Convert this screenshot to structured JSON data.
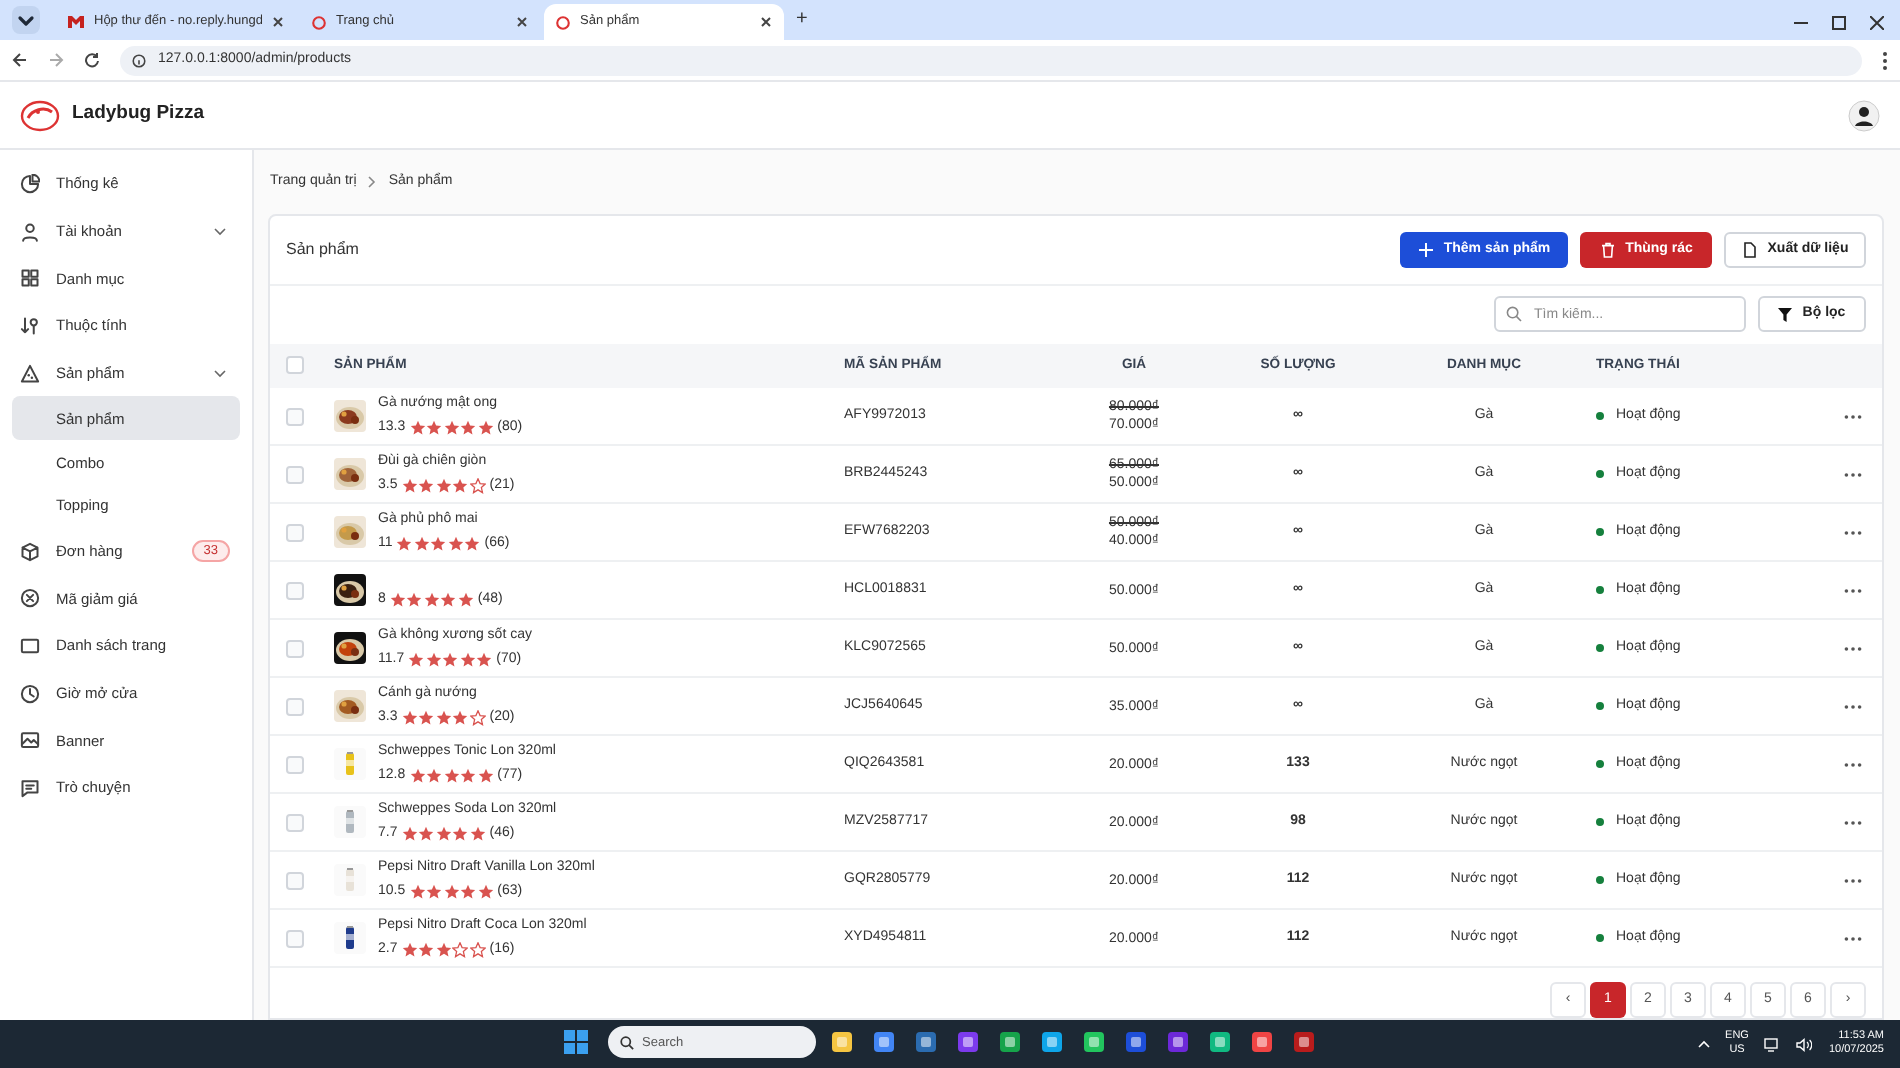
{
  "browser": {
    "tabs": [
      {
        "title": "Hộp thư đến - no.reply.hungd",
        "selected": false
      },
      {
        "title": "Trang chủ",
        "selected": false
      },
      {
        "title": "Sản phẩm",
        "selected": true
      }
    ],
    "new_tab": "+",
    "url": "127.0.0.1:8000/admin/products"
  },
  "app": {
    "brand": "Ladybug Pizza"
  },
  "sidebar": {
    "items": [
      {
        "label": "Thống kê",
        "kind": "link",
        "selected": false
      },
      {
        "label": "Tài khoản",
        "kind": "group",
        "selected": false
      },
      {
        "label": "Danh mục",
        "kind": "link",
        "selected": false
      },
      {
        "label": "Thuộc tính",
        "kind": "link",
        "selected": false
      },
      {
        "label": "Sản phẩm",
        "kind": "group",
        "selected": false,
        "children": [
          {
            "label": "Sản phẩm",
            "selected": true
          },
          {
            "label": "Combo",
            "selected": false
          },
          {
            "label": "Topping",
            "selected": false
          }
        ]
      },
      {
        "label": "Đơn hàng",
        "kind": "link",
        "selected": false,
        "badge": "33"
      },
      {
        "label": "Mã giảm giá",
        "kind": "link",
        "selected": false
      },
      {
        "label": "Danh sách trang",
        "kind": "link",
        "selected": false
      },
      {
        "label": "Giờ mở cửa",
        "kind": "link",
        "selected": false
      },
      {
        "label": "Banner",
        "kind": "link",
        "selected": false
      },
      {
        "label": "Trò chuyện",
        "kind": "link",
        "selected": false
      }
    ]
  },
  "breadcrumb": [
    "Trang quản trị",
    "Sản phẩm"
  ],
  "card": {
    "title": "Sản phẩm",
    "buttons": [
      {
        "label": "Thêm sản phẩm",
        "kind": "primary"
      },
      {
        "label": "Thùng rác",
        "kind": "danger"
      },
      {
        "label": "Xuất dữ liệu",
        "kind": "outline"
      }
    ],
    "search": {
      "placeholder": "Tìm kiếm..."
    },
    "filter": "Bộ lọc"
  },
  "table": {
    "select_all": {
      "checked": false
    },
    "columns": [
      "SẢN PHẨM",
      "MÃ SẢN PHẨM",
      "GIÁ",
      "SỐ LƯỢNG",
      "DANH MỤC",
      "TRẠNG THÁI"
    ],
    "rows": [
      {
        "checked": false,
        "name": "Gà nướng mật ong",
        "rating": "13.3",
        "stars": 5,
        "reviews": "(80)",
        "code": "AFY9972013",
        "old_price": "80.000₫",
        "price": "70.000₫",
        "quantity": "∞",
        "category": "Gà",
        "status": "Hoạt động",
        "color": "#15803d"
      },
      {
        "checked": false,
        "name": "Đùi gà chiên giòn",
        "rating": "3.5",
        "stars": 4,
        "reviews": "(21)",
        "code": "BRB2445243",
        "old_price": "65.000₫",
        "price": "50.000₫",
        "quantity": "∞",
        "category": "Gà",
        "status": "Hoạt động",
        "color": "#15803d"
      },
      {
        "checked": false,
        "name": "Gà phủ phô mai",
        "rating": "11",
        "stars": 5,
        "reviews": "(66)",
        "code": "EFW7682203",
        "old_price": "50.000₫",
        "price": "40.000₫",
        "quantity": "∞",
        "category": "Gà",
        "status": "Hoạt động",
        "color": "#15803d"
      },
      {
        "checked": false,
        "rating": "8",
        "stars": 5,
        "reviews": "(48)",
        "code": "HCL0018831",
        "price": "50.000₫",
        "quantity": "∞",
        "category": "Gà",
        "status": "Hoạt động",
        "color": "#15803d"
      },
      {
        "checked": false,
        "name": "Gà không xương sốt cay",
        "rating": "11.7",
        "stars": 5,
        "reviews": "(70)",
        "code": "KLC9072565",
        "price": "50.000₫",
        "quantity": "∞",
        "category": "Gà",
        "status": "Hoạt động",
        "color": "#15803d"
      },
      {
        "checked": false,
        "name": "Cánh gà nướng",
        "rating": "3.3",
        "stars": 4,
        "reviews": "(20)",
        "code": "JCJ5640645",
        "price": "35.000₫",
        "quantity": "∞",
        "category": "Gà",
        "status": "Hoạt động",
        "color": "#15803d"
      },
      {
        "checked": false,
        "name": "Schweppes Tonic Lon 320ml",
        "rating": "12.8",
        "stars": 5,
        "reviews": "(77)",
        "code": "QIQ2643581",
        "price": "20.000₫",
        "quantity": "133",
        "category": "Nước ngọt",
        "status": "Hoạt động",
        "color": "#15803d"
      },
      {
        "checked": false,
        "name": "Schweppes Soda Lon 320ml",
        "rating": "7.7",
        "stars": 5,
        "reviews": "(46)",
        "code": "MZV2587717",
        "price": "20.000₫",
        "quantity": "98",
        "category": "Nước ngọt",
        "status": "Hoạt động",
        "color": "#15803d"
      },
      {
        "checked": false,
        "name": "Pepsi Nitro Draft Vanilla Lon 320ml",
        "rating": "10.5",
        "stars": 5,
        "reviews": "(63)",
        "code": "GQR2805779",
        "price": "20.000₫",
        "quantity": "112",
        "category": "Nước ngọt",
        "status": "Hoạt động",
        "color": "#15803d"
      },
      {
        "checked": false,
        "name": "Pepsi Nitro Draft Coca Lon 320ml",
        "rating": "2.7",
        "stars": 3,
        "reviews": "(16)",
        "code": "XYD4954811",
        "price": "20.000₫",
        "quantity": "112",
        "category": "Nước ngọt",
        "status": "Hoạt động",
        "color": "#15803d"
      }
    ]
  },
  "pagination": {
    "prev": "‹",
    "next": "›",
    "pages": [
      {
        "label": "1",
        "selected": true
      },
      {
        "label": "2",
        "selected": false
      },
      {
        "label": "3",
        "selected": false
      },
      {
        "label": "4",
        "selected": false
      },
      {
        "label": "5",
        "selected": false
      },
      {
        "label": "6",
        "selected": false
      }
    ]
  },
  "taskbar": {
    "search": {
      "placeholder": "Search"
    },
    "language": "ENG",
    "region": "US",
    "time": "11:53 AM",
    "date": "10/07/2025"
  }
}
